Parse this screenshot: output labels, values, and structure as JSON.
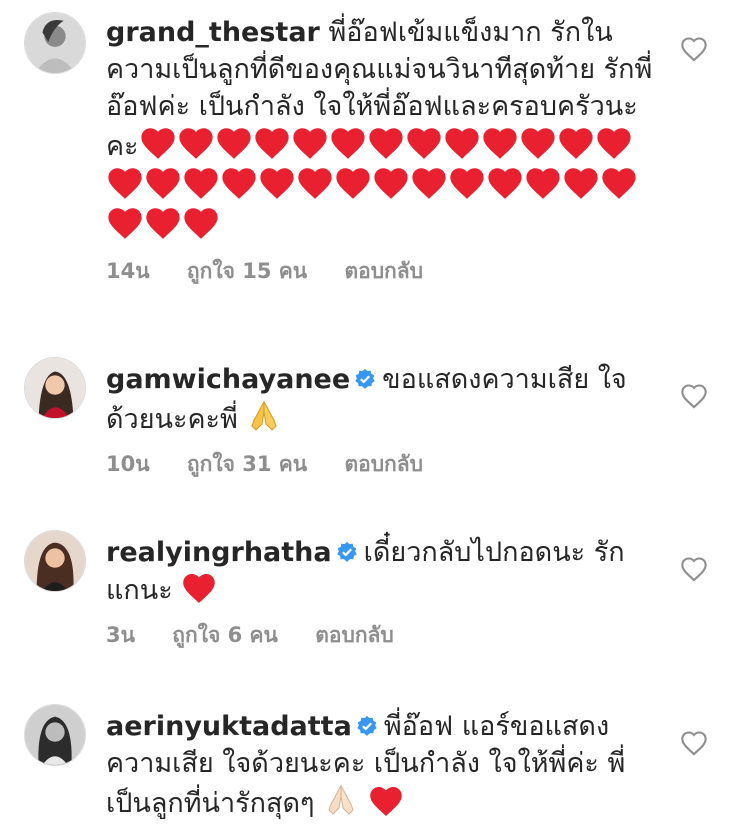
{
  "colors": {
    "heart": "#e8202f",
    "verified": "#3897f0",
    "meta": "#8e8e8e"
  },
  "comments": [
    {
      "username": "grand_thestar",
      "verified": false,
      "text": "พี่อ๊อฟเข้มแข็งมาก รักในความเป็นลูกที่ดีของคุณแม่จนวินาทีสุดท้าย รักพี่อ๊อฟค่ะ เป็นกำลัง ใจให้พี่อ๊อฟและครอบครัวนะ",
      "text_tail": "คะ",
      "emoji": "red-heart",
      "emoji_count": 30,
      "time": "14น",
      "likes": "ถูกใจ 15 คน",
      "reply": "ตอบกลับ"
    },
    {
      "username": "gamwichayanee",
      "verified": true,
      "text": "ขอแสดงความเสีย ใจด้วยนะคะพี่",
      "emoji": "folded-hands",
      "emoji_count": 1,
      "time": "10น",
      "likes": "ถูกใจ 31 คน",
      "reply": "ตอบกลับ"
    },
    {
      "username": "realyingrhatha",
      "verified": true,
      "text": "เดี๋ยวกลับไปกอดนะ รักแกนะ",
      "emoji": "red-heart",
      "emoji_count": 1,
      "time": "3น",
      "likes": "ถูกใจ 6 คน",
      "reply": "ตอบกลับ"
    },
    {
      "username": "aerinyuktadatta",
      "verified": true,
      "text": "พี่อ๊อฟ แอร์ขอแสดงความเสีย ใจด้วยนะคะ เป็นกำลัง ใจให้พี่ค่ะ พี่เป็นลูกที่น่ารักสุดๆ",
      "emoji": "folded-hands-light, red-heart",
      "emoji_count": 2
    }
  ]
}
